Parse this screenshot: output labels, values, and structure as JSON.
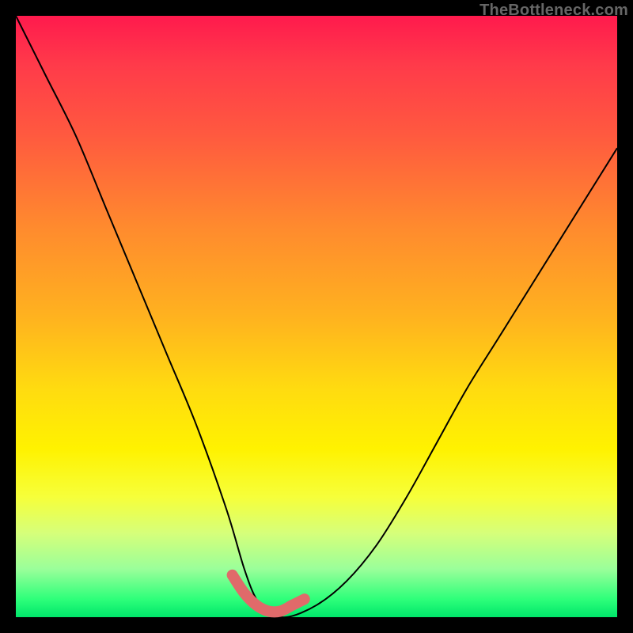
{
  "watermark": "TheBottleneck.com",
  "chart_data": {
    "type": "line",
    "title": "",
    "xlabel": "",
    "ylabel": "",
    "xlim": [
      0,
      100
    ],
    "ylim": [
      0,
      100
    ],
    "grid": false,
    "legend": false,
    "background_gradient": {
      "orientation": "vertical",
      "stops": [
        {
          "pos": 0,
          "color": "#ff1a4d"
        },
        {
          "pos": 35,
          "color": "#ff8a2e"
        },
        {
          "pos": 62,
          "color": "#ffdb10"
        },
        {
          "pos": 80,
          "color": "#f6ff3a"
        },
        {
          "pos": 100,
          "color": "#00e66a"
        }
      ]
    },
    "series": [
      {
        "name": "bottleneck-curve",
        "x": [
          0,
          5,
          10,
          15,
          20,
          25,
          30,
          35,
          38,
          40,
          42,
          45,
          50,
          55,
          60,
          65,
          70,
          75,
          80,
          85,
          90,
          95,
          100
        ],
        "y": [
          100,
          90,
          80,
          68,
          56,
          44,
          32,
          18,
          8,
          3,
          1,
          0,
          2,
          6,
          12,
          20,
          29,
          38,
          46,
          54,
          62,
          70,
          78
        ]
      }
    ],
    "highlight_segment": {
      "name": "optimum-band",
      "x": [
        36,
        38,
        40,
        42,
        44,
        46,
        48
      ],
      "y": [
        7,
        4,
        2,
        1,
        1,
        2,
        3
      ]
    }
  }
}
